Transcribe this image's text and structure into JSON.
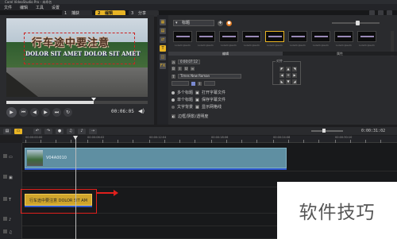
{
  "window": {
    "title": "Corel VideoStudio Pro - 未命名"
  },
  "menu": [
    "文件",
    "编辑",
    "工具",
    "设置"
  ],
  "steps": [
    {
      "num": "1",
      "label": "捕获",
      "active": false
    },
    {
      "num": "2",
      "label": "编辑",
      "active": true
    },
    {
      "num": "3",
      "label": "分享",
      "active": false
    }
  ],
  "preview": {
    "title_main": "行车途中要注意",
    "title_sub": "DOLOR SIT AMET DOLOR SIT AMET",
    "progress": 0.62,
    "timecode": "00:06:05"
  },
  "library": {
    "category": "标题",
    "thumb_caption": "Lorem ipsum",
    "thumb_count": 9,
    "tabs": [
      "编辑",
      "属性"
    ],
    "duration": "0:00:07:12",
    "font": "Times New Roman",
    "options": [
      "多个标题",
      "单个标题",
      "文字背景",
      "打开字幕文件",
      "保存字幕文件",
      "显示网格线"
    ],
    "align_label": "对齐",
    "apply_text": "边框/阴影/透明度"
  },
  "timeline": {
    "time": "0:00:31:02",
    "ruler_labels": [
      "00:00:00:00",
      "00:00:06:02",
      "00:00:12:04",
      "00:00:18:06",
      "00:00:24:08",
      "00:00:30:10"
    ],
    "video_clip_name": "V04A0010",
    "title_clip_name": "行车途中要注意 DOLOR SIT AM"
  },
  "watermark": "软件技巧"
}
